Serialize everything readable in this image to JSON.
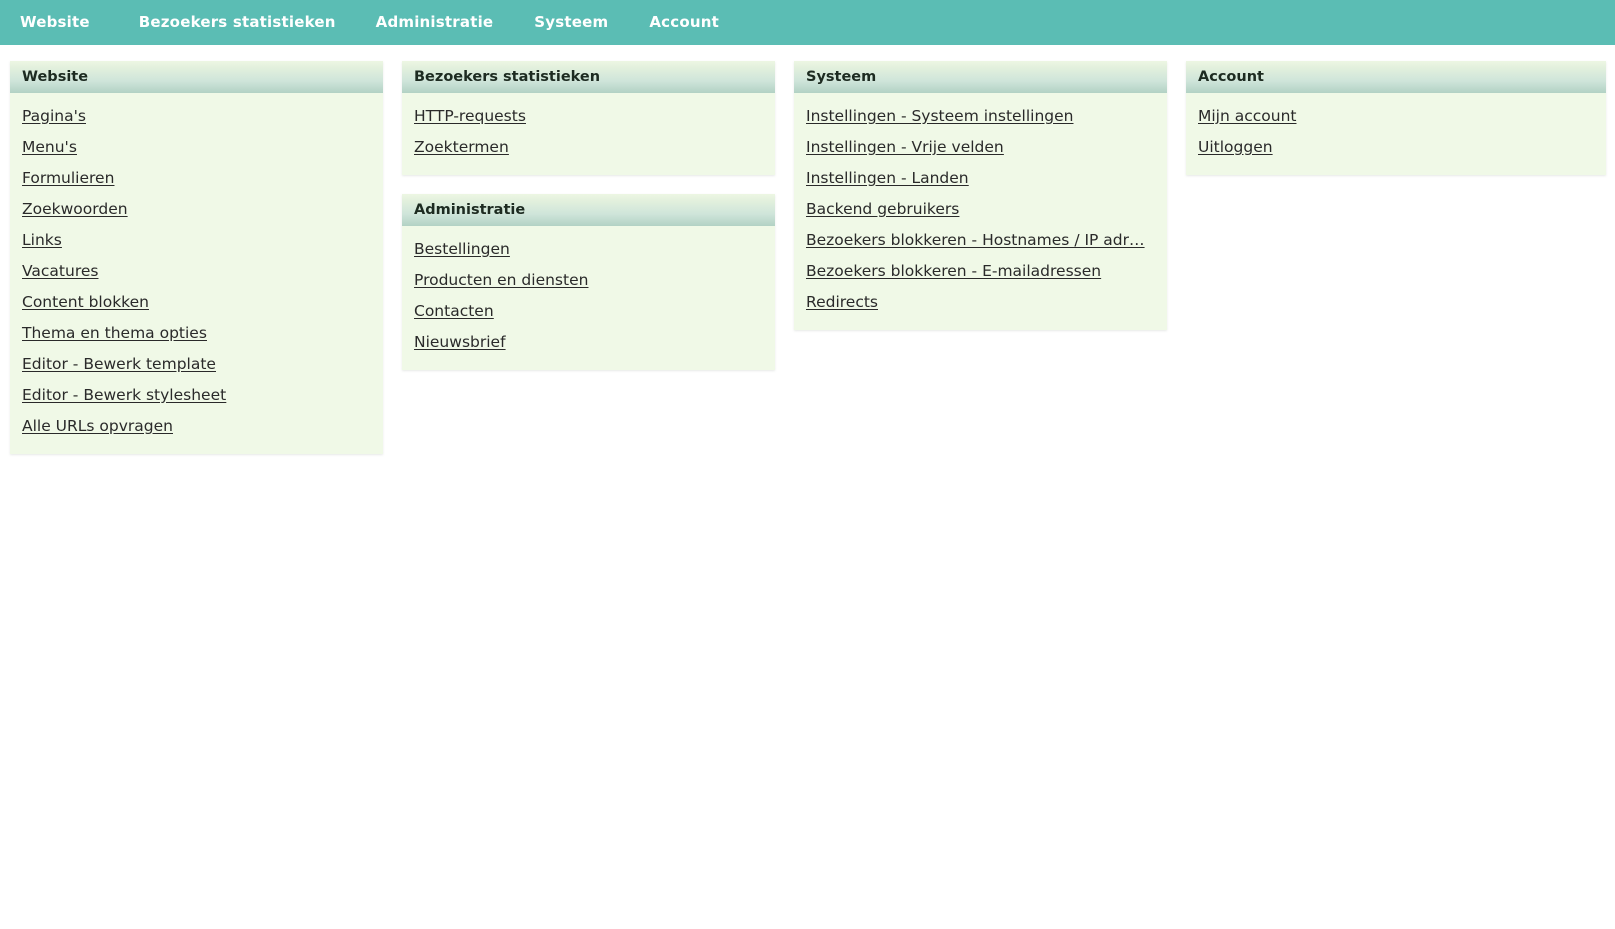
{
  "colors": {
    "navbar_background": "#5bbdb4",
    "navbar_text": "#ffffff",
    "panel_body_background": "#f0f9e7",
    "panel_header_gradient_top": "#edf7e3",
    "panel_header_gradient_bottom": "#b3d2c5",
    "link_text": "#2a2a2a",
    "heading_text": "#1d2b21",
    "page_background": "#ffffff"
  },
  "navbar": {
    "items": [
      {
        "label": "Website"
      },
      {
        "label": "Bezoekers statistieken"
      },
      {
        "label": "Administratie"
      },
      {
        "label": "Systeem"
      },
      {
        "label": "Account"
      }
    ]
  },
  "columns": [
    {
      "panels": [
        {
          "title": "Website",
          "links": [
            {
              "label": "Pagina's"
            },
            {
              "label": "Menu's"
            },
            {
              "label": "Formulieren"
            },
            {
              "label": "Zoekwoorden"
            },
            {
              "label": "Links"
            },
            {
              "label": "Vacatures"
            },
            {
              "label": "Content blokken"
            },
            {
              "label": "Thema en thema opties"
            },
            {
              "label": "Editor - Bewerk template"
            },
            {
              "label": "Editor - Bewerk stylesheet"
            },
            {
              "label": "Alle URLs opvragen"
            }
          ]
        }
      ]
    },
    {
      "panels": [
        {
          "title": "Bezoekers statistieken",
          "links": [
            {
              "label": "HTTP-requests"
            },
            {
              "label": "Zoektermen"
            }
          ]
        },
        {
          "title": "Administratie",
          "links": [
            {
              "label": "Bestellingen"
            },
            {
              "label": "Producten en diensten"
            },
            {
              "label": "Contacten"
            },
            {
              "label": "Nieuwsbrief"
            }
          ]
        }
      ]
    },
    {
      "panels": [
        {
          "title": "Systeem",
          "links": [
            {
              "label": "Instellingen - Systeem instellingen"
            },
            {
              "label": "Instellingen - Vrije velden"
            },
            {
              "label": "Instellingen - Landen"
            },
            {
              "label": "Backend gebruikers"
            },
            {
              "label": "Bezoekers blokkeren - Hostnames / IP adr…"
            },
            {
              "label": "Bezoekers blokkeren - E-mailadressen"
            },
            {
              "label": "Redirects"
            }
          ]
        }
      ]
    },
    {
      "panels": [
        {
          "title": "Account",
          "links": [
            {
              "label": "Mijn account"
            },
            {
              "label": "Uitloggen"
            }
          ]
        }
      ]
    }
  ]
}
